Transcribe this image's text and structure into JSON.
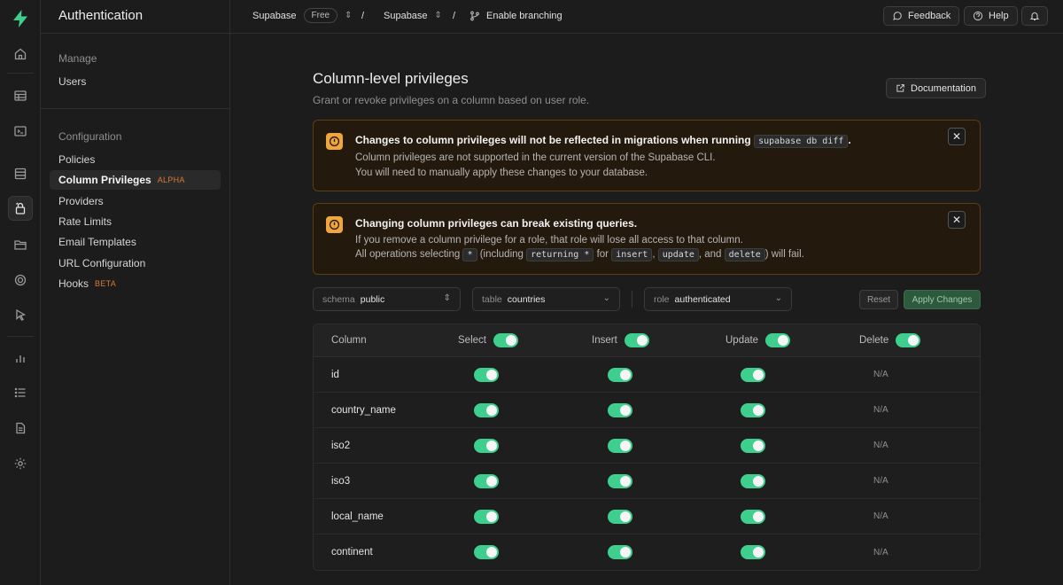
{
  "sidebar": {
    "title": "Authentication",
    "manage_label": "Manage",
    "manage_items": [
      "Users"
    ],
    "config_label": "Configuration",
    "config_items": [
      {
        "label": "Policies",
        "badge": ""
      },
      {
        "label": "Column Privileges",
        "badge": "ALPHA"
      },
      {
        "label": "Providers",
        "badge": ""
      },
      {
        "label": "Rate Limits",
        "badge": ""
      },
      {
        "label": "Email Templates",
        "badge": ""
      },
      {
        "label": "URL Configuration",
        "badge": ""
      },
      {
        "label": "Hooks",
        "badge": "BETA"
      }
    ]
  },
  "topbar": {
    "org": "Supabase",
    "plan": "Free",
    "project": "Supabase",
    "branching": "Enable branching",
    "feedback": "Feedback",
    "help": "Help"
  },
  "page": {
    "title": "Column-level privileges",
    "subtitle": "Grant or revoke privileges on a column based on user role.",
    "documentation": "Documentation"
  },
  "alert1": {
    "title_pre": "Changes to column privileges will not be reflected in migrations when running",
    "title_code": "supabase db diff",
    "title_post": ".",
    "line1": "Column privileges are not supported in the current version of the Supabase CLI.",
    "line2": "You will need to manually apply these changes to your database."
  },
  "alert2": {
    "title": "Changing column privileges can break existing queries.",
    "line1": "If you remove a column privilege for a role, that role will lose all access to that column.",
    "line2_a": "All operations selecting",
    "code_star": "*",
    "line2_b": "(including",
    "code_returning": "returning *",
    "line2_c": "for",
    "code_insert": "insert",
    "comma": ",",
    "code_update": "update",
    "line2_d": ", and",
    "code_delete": "delete",
    "line2_e": ") will fail."
  },
  "filters": {
    "schema_key": "schema",
    "schema_value": "public",
    "table_key": "table",
    "table_value": "countries",
    "role_key": "role",
    "role_value": "authenticated",
    "reset": "Reset",
    "apply": "Apply Changes"
  },
  "table": {
    "headers": [
      "Column",
      "Select",
      "Insert",
      "Update",
      "Delete"
    ],
    "na_label": "N/A",
    "rows": [
      {
        "column": "id",
        "select": true,
        "insert": true,
        "update": true
      },
      {
        "column": "country_name",
        "select": true,
        "insert": true,
        "update": true
      },
      {
        "column": "iso2",
        "select": true,
        "insert": true,
        "update": true
      },
      {
        "column": "iso3",
        "select": true,
        "insert": true,
        "update": true
      },
      {
        "column": "local_name",
        "select": true,
        "insert": true,
        "update": true
      },
      {
        "column": "continent",
        "select": true,
        "insert": true,
        "update": true
      }
    ]
  },
  "colors": {
    "accent": "#3ecf8e",
    "warning": "#f0a63c",
    "badge": "#d77a3a"
  },
  "icons": [
    "logo-bolt-icon",
    "home-icon",
    "table-editor-icon",
    "sql-editor-icon",
    "database-icon",
    "auth-icon",
    "storage-icon",
    "realtime-icon",
    "edge-functions-icon",
    "reports-icon",
    "logs-icon",
    "api-docs-icon",
    "settings-icon"
  ]
}
